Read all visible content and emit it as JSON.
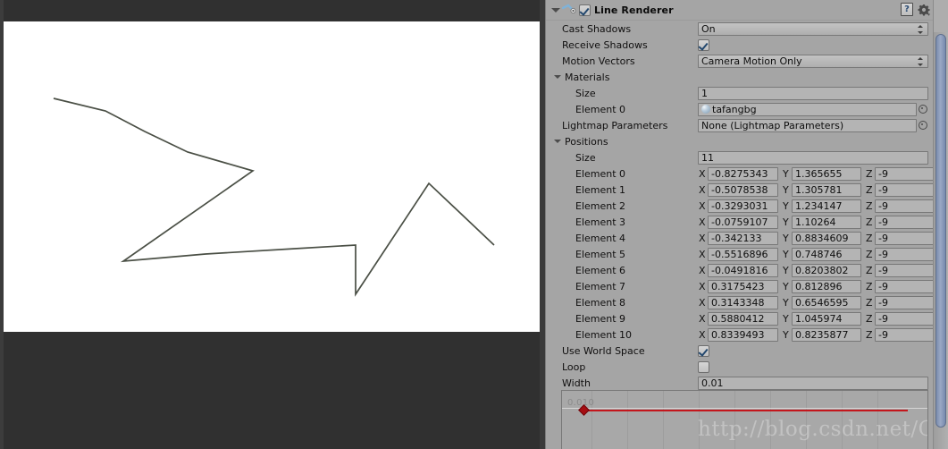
{
  "scene": {
    "name": "game-view",
    "background": "#ffffff",
    "chrome_color": "#303030",
    "line_color": "#4a4f45",
    "line_points": "60,86 118,100 162,123 210,146 283,167 138,268 230,260 330,254 398,250 398,305 480,181 553,250"
  },
  "inspector": {
    "component": {
      "title": "Line Renderer",
      "enabled": true,
      "help_icon": "help-icon",
      "gear_icon": "gear-icon",
      "foldout_icon": "foldout-triangle-icon",
      "component_icon": "line-renderer-icon"
    },
    "cast_shadows": {
      "label": "Cast Shadows",
      "value": "On"
    },
    "receive_shadows": {
      "label": "Receive Shadows",
      "value": true
    },
    "motion_vectors": {
      "label": "Motion Vectors",
      "value": "Camera Motion Only"
    },
    "materials": {
      "label": "Materials",
      "size_label": "Size",
      "size_value": "1",
      "element_label": "Element 0",
      "element_value": "tafangbg"
    },
    "lightmap_parameters": {
      "label": "Lightmap Parameters",
      "value": "None (Lightmap Parameters)"
    },
    "positions": {
      "label": "Positions",
      "size_label": "Size",
      "size_value": "11",
      "axis_x": "X",
      "axis_y": "Y",
      "axis_z": "Z",
      "elements": [
        {
          "label": "Element 0",
          "x": "-0.8275343",
          "y": "1.365655",
          "z": "-9"
        },
        {
          "label": "Element 1",
          "x": "-0.5078538",
          "y": "1.305781",
          "z": "-9"
        },
        {
          "label": "Element 2",
          "x": "-0.3293031",
          "y": "1.234147",
          "z": "-9"
        },
        {
          "label": "Element 3",
          "x": "-0.0759107",
          "y": "1.10264",
          "z": "-9"
        },
        {
          "label": "Element 4",
          "x": "-0.342133",
          "y": "0.8834609",
          "z": "-9"
        },
        {
          "label": "Element 5",
          "x": "-0.5516896",
          "y": "0.748746",
          "z": "-9"
        },
        {
          "label": "Element 6",
          "x": "-0.0491816",
          "y": "0.8203802",
          "z": "-9"
        },
        {
          "label": "Element 7",
          "x": "0.3175423",
          "y": "0.812896",
          "z": "-9"
        },
        {
          "label": "Element 8",
          "x": "0.3143348",
          "y": "0.6546595",
          "z": "-9"
        },
        {
          "label": "Element 9",
          "x": "0.5880412",
          "y": "1.045974",
          "z": "-9"
        },
        {
          "label": "Element 10",
          "x": "0.8339493",
          "y": "0.8235877",
          "z": "-9"
        }
      ]
    },
    "use_world_space": {
      "label": "Use World Space",
      "value": true
    },
    "loop": {
      "label": "Loop",
      "value": false
    },
    "width": {
      "label": "Width",
      "value": "0.01"
    },
    "width_curve": {
      "value_label": "0.010",
      "curve_color": "#c4161c",
      "keyframe_count": 1
    }
  },
  "watermark": {
    "text": "http://blog.csdn.net/Czhenya"
  },
  "colors": {
    "panel_bg": "#a5a5a5",
    "field_bg": "#b4b4b4",
    "scene_chrome": "#303030",
    "scrollbar_thumb": "#8b9ab9",
    "curve_red": "#c4161c"
  }
}
